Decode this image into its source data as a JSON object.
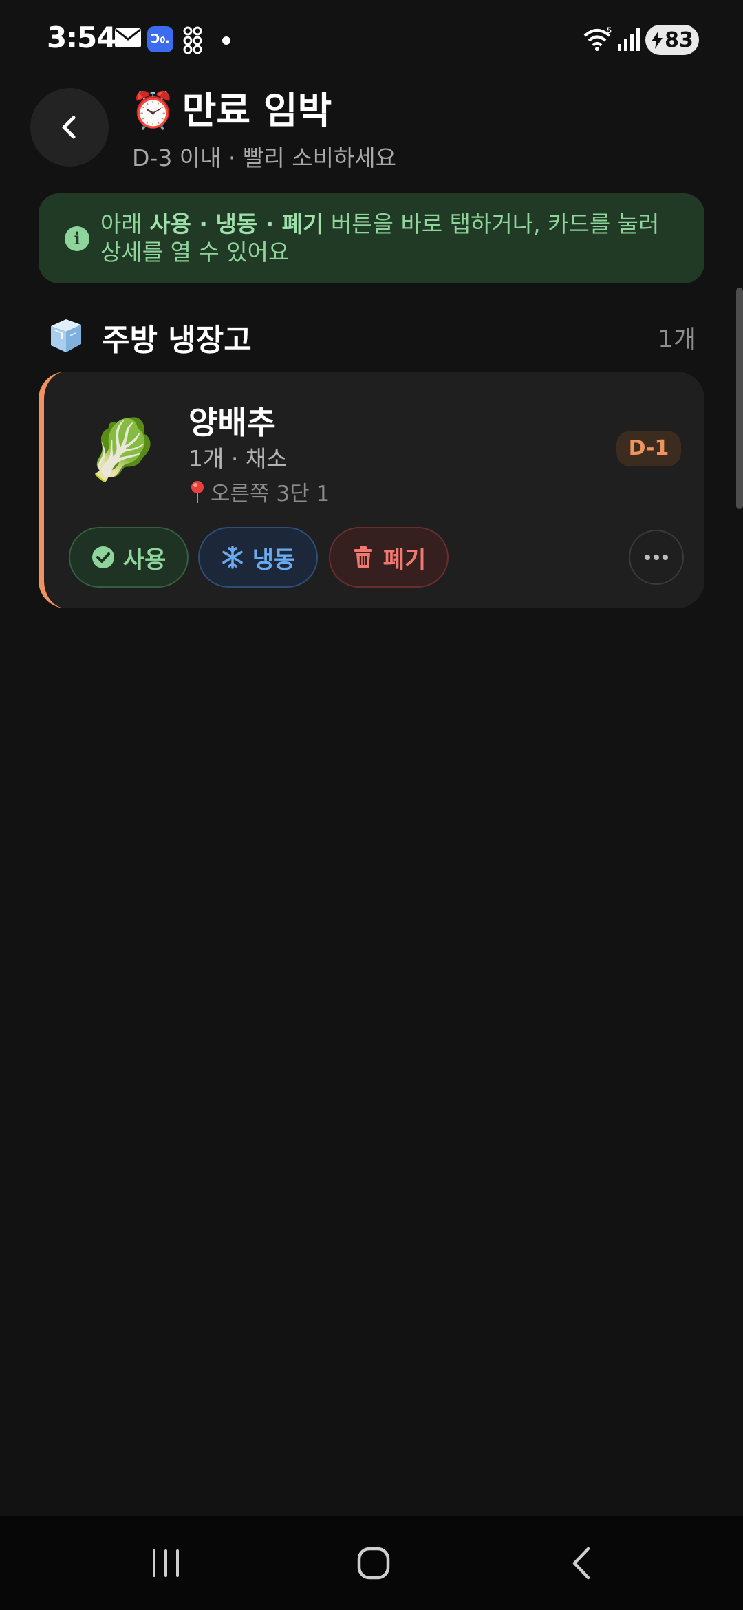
{
  "status_bar": {
    "time": "3:54",
    "app_badge": "Ɔ᥆.",
    "battery_level": "83",
    "icons": [
      "mail-icon",
      "app-badge-icon",
      "grid-icon",
      "dot-icon",
      "wifi-icon",
      "signal-icon",
      "battery-charging-icon"
    ]
  },
  "header": {
    "back_icon": "chevron-left-icon",
    "title_emoji": "⏰",
    "title": "만료 임박",
    "subtitle": "D-3 이내 · 빨리 소비하세요"
  },
  "info_banner": {
    "icon": "info-icon",
    "text_prefix": "아래 ",
    "text_bold": "사용 · 냉동 · 폐기",
    "text_suffix": " 버튼을 바로 탭하거나, 카드를 눌러 상세를 열 수 있어요",
    "color": "#8fd49b"
  },
  "section": {
    "icon": "ice-cube-icon",
    "title": "주방 냉장고",
    "count": "1개"
  },
  "items": [
    {
      "emoji": "🥬",
      "name": "양배추",
      "meta": "1개 · 채소",
      "location": "오른쪽 3단 1",
      "dday": "D-1",
      "accent_color": "#f0935e",
      "actions": {
        "use": "사용",
        "freeze": "냉동",
        "discard": "폐기"
      }
    }
  ],
  "nav_bar": {
    "buttons": [
      "recents-icon",
      "home-icon",
      "back-icon"
    ]
  }
}
